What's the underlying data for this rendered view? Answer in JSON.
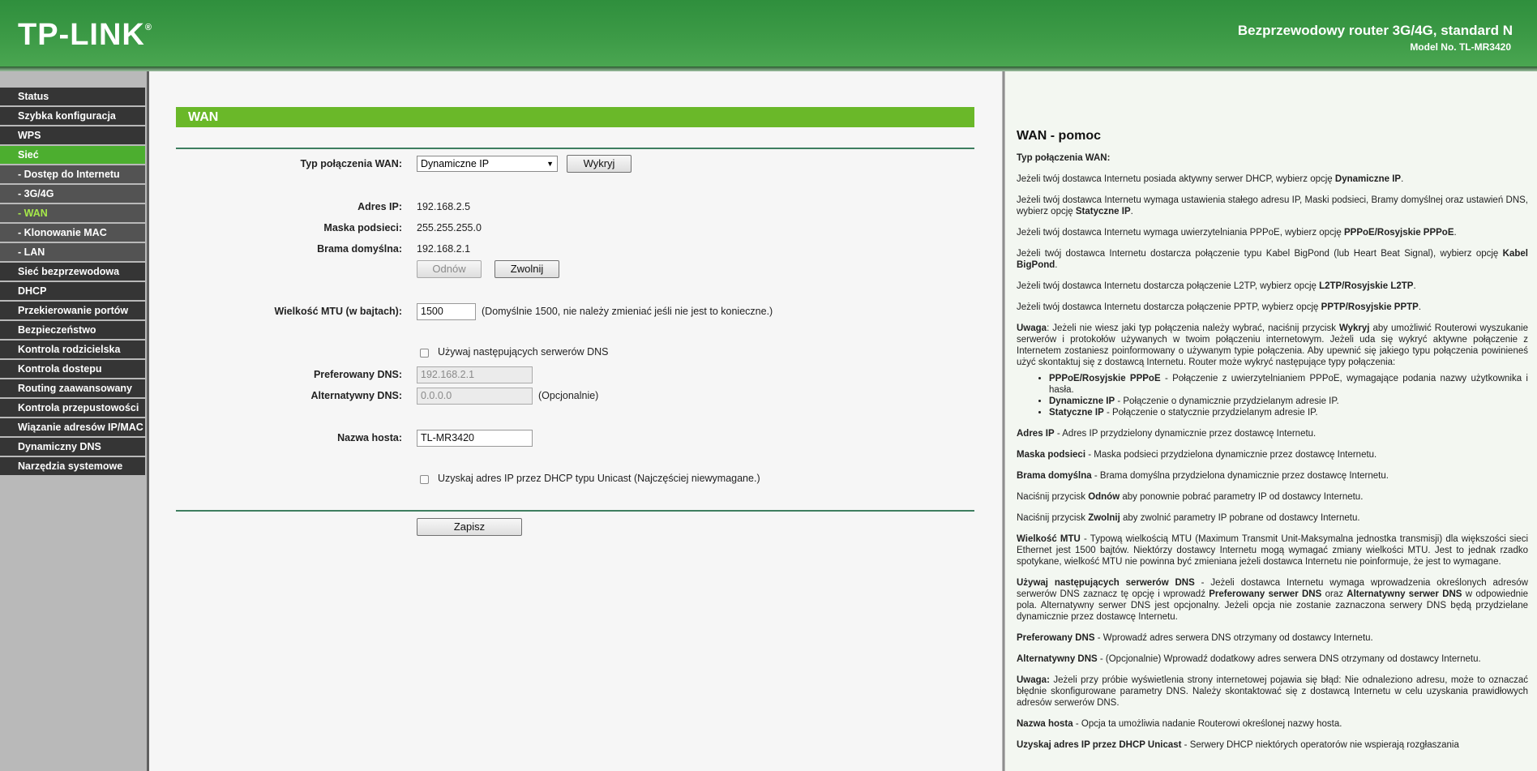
{
  "header": {
    "logo": "TP-LINK",
    "logo_mark": "®",
    "product_title": "Bezprzewodowy router 3G/4G, standard N",
    "model": "Model No. TL-MR3420"
  },
  "sidebar": {
    "items": [
      {
        "label": "Status"
      },
      {
        "label": "Szybka konfiguracja"
      },
      {
        "label": "WPS"
      },
      {
        "label": "Sieć"
      },
      {
        "label": "- Dostęp do Internetu"
      },
      {
        "label": "- 3G/4G"
      },
      {
        "label": "- WAN"
      },
      {
        "label": "- Klonowanie MAC"
      },
      {
        "label": "- LAN"
      },
      {
        "label": "Sieć bezprzewodowa"
      },
      {
        "label": "DHCP"
      },
      {
        "label": "Przekierowanie portów"
      },
      {
        "label": "Bezpieczeństwo"
      },
      {
        "label": "Kontrola rodzicielska"
      },
      {
        "label": "Kontrola dostepu"
      },
      {
        "label": "Routing zaawansowany"
      },
      {
        "label": "Kontrola przepustowości"
      },
      {
        "label": "Wiązanie adresów IP/MAC"
      },
      {
        "label": "Dynamiczny DNS"
      },
      {
        "label": "Narzędzia systemowe"
      }
    ]
  },
  "form": {
    "title": "WAN",
    "wan_type_label": "Typ połączenia WAN:",
    "wan_type_value": "Dynamiczne IP",
    "detect_button": "Wykryj",
    "ip_label": "Adres IP:",
    "ip_value": "192.168.2.5",
    "mask_label": "Maska podsieci:",
    "mask_value": "255.255.255.0",
    "gateway_label": "Brama domyślna:",
    "gateway_value": "192.168.2.1",
    "renew_button": "Odnów",
    "release_button": "Zwolnij",
    "mtu_label": "Wielkość MTU (w bajtach):",
    "mtu_value": "1500",
    "mtu_hint": "(Domyślnie 1500, nie należy zmieniać jeśli nie jest to konieczne.)",
    "dns_checkbox_label": "Używaj następujących serwerów DNS",
    "primary_dns_label": "Preferowany DNS:",
    "primary_dns_value": "192.168.2.1",
    "secondary_dns_label": "Alternatywny DNS:",
    "secondary_dns_value": "0.0.0.0",
    "secondary_dns_hint": "(Opcjonalnie)",
    "hostname_label": "Nazwa hosta:",
    "hostname_value": "TL-MR3420",
    "unicast_label": "Uzyskaj adres IP przez DHCP typu Unicast (Najczęściej niewymagane.)",
    "save_button": "Zapisz"
  },
  "help": {
    "title": "WAN - pomoc",
    "wan_type_heading": "Typ połączenia WAN:",
    "p_dynamic_a": "Jeżeli twój dostawca Internetu posiada aktywny serwer DHCP, wybierz opcję ",
    "p_dynamic_b": "Dynamiczne IP",
    "p_dynamic_c": ".",
    "p_static_a": "Jeżeli twój dostawca Internetu wymaga ustawienia stałego adresu IP, Maski podsieci, Bramy domyślnej oraz ustawień DNS, wybierz opcję ",
    "p_static_b": "Statyczne IP",
    "p_static_c": ".",
    "p_pppoe_a": "Jeżeli twój dostawca Internetu wymaga uwierzytelniania PPPoE, wybierz opcję ",
    "p_pppoe_b": "PPPoE/Rosyjskie PPPoE",
    "p_pppoe_c": ".",
    "p_bigpond_a": "Jeżeli twój dostawca Internetu dostarcza połączenie typu Kabel BigPond (lub Heart Beat Signal), wybierz opcję ",
    "p_bigpond_b": "Kabel BigPond",
    "p_bigpond_c": ".",
    "p_l2tp_a": "Jeżeli twój dostawca Internetu dostarcza połączenie L2TP, wybierz opcję ",
    "p_l2tp_b": "L2TP/Rosyjskie L2TP",
    "p_l2tp_c": ".",
    "p_pptp_a": "Jeżeli twój dostawca Internetu dostarcza połączenie PPTP, wybierz opcję ",
    "p_pptp_b": "PPTP/Rosyjskie PPTP",
    "p_pptp_c": ".",
    "note1_a": "Uwaga",
    "note1_b": ": Jeżeli nie wiesz jaki typ połączenia należy wybrać, naciśnij przycisk ",
    "note1_c": "Wykryj",
    "note1_d": " aby umożliwić Routerowi wyszukanie serwerów i protokołów używanych w twoim połączeniu internetowym. Jeżeli uda się wykryć aktywne połączenie z Internetem zostaniesz poinformowany o używanym typie połączenia. Aby upewnić się jakiego typu połączenia powinieneś użyć skontaktuj się z dostawcą Internetu. Router może wykryć następujące typy połączenia:",
    "li1_a": "PPPoE/Rosyjskie PPPoE",
    "li1_b": " - Połączenie z uwierzytelnianiem PPPoE, wymagające podania nazwy użytkownika i hasła.",
    "li2_a": "Dynamiczne IP",
    "li2_b": " - Połączenie o dynamicznie przydzielanym adresie IP.",
    "li3_a": "Statyczne IP",
    "li3_b": " - Połączenie o statycznie przydzielanym adresie IP.",
    "ip_a": "Adres IP",
    "ip_b": " - Adres IP przydzielony dynamicznie przez dostawcę Internetu.",
    "mask_a": "Maska podsieci",
    "mask_b": " - Maska podsieci przydzielona dynamicznie przez dostawcę Internetu.",
    "gw_a": "Brama domyślna",
    "gw_b": " - Brama domyślna przydzielona dynamicznie przez dostawcę Internetu.",
    "renew_a": "Naciśnij przycisk ",
    "renew_b": "Odnów",
    "renew_c": " aby ponownie pobrać parametry IP od dostawcy Internetu.",
    "release_a": "Naciśnij przycisk ",
    "release_b": "Zwolnij",
    "release_c": " aby zwolnić parametry IP pobrane od dostawcy Internetu.",
    "mtu_a": "Wielkość MTU",
    "mtu_b": " - Typową wielkością MTU (Maximum Transmit Unit-Maksymalna jednostka transmisji) dla większości sieci Ethernet jest 1500 bajtów. Niektórzy dostawcy Internetu mogą wymagać zmiany wielkości MTU. Jest to jednak rzadko spotykane, wielkość MTU nie powinna być zmieniana jeżeli dostawca Internetu nie poinformuje, że jest to wymagane.",
    "dns_a": "Używaj następujących serwerów DNS",
    "dns_b": " - Jeżeli dostawca Internetu wymaga wprowadzenia określonych adresów serwerów DNS zaznacz tę opcję i wprowadź ",
    "dns_c": "Preferowany serwer DNS",
    "dns_d": " oraz ",
    "dns_e": "Alternatywny serwer DNS",
    "dns_f": " w odpowiednie pola. Alternatywny serwer DNS jest opcjonalny. Jeżeli opcja nie zostanie zaznaczona serwery DNS będą przydzielane dynamicznie przez dostawcę Internetu.",
    "pdns_a": "Preferowany DNS",
    "pdns_b": " - Wprowadź adres serwera DNS otrzymany od dostawcy Internetu.",
    "adns_a": "Alternatywny DNS",
    "adns_b": " - (Opcjonalnie) Wprowadź dodatkowy adres serwera DNS otrzymany od dostawcy Internetu.",
    "note2_a": "Uwaga:",
    "note2_b": " Jeżeli przy próbie wyświetlenia strony internetowej pojawia się błąd: Nie odnaleziono adresu, może to oznaczać błędnie skonfigurowane parametry DNS. Należy skontaktować się z dostawcą Internetu w celu uzyskania prawidłowych adresów serwerów DNS.",
    "host_a": "Nazwa hosta",
    "host_b": " - Opcja ta umożliwia nadanie Routerowi określonej nazwy hosta.",
    "unicast_a": "Uzyskaj adres IP przez DHCP Unicast",
    "unicast_b": " - Serwery DHCP niektórych operatorów nie wspierają rozgłaszania"
  }
}
